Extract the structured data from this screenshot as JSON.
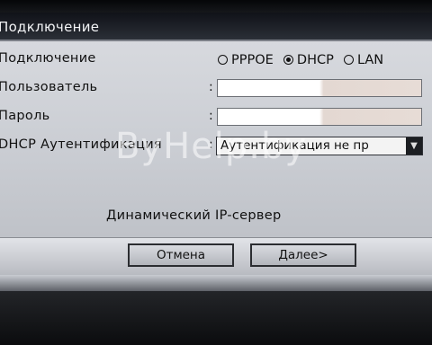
{
  "window": {
    "title": "Подключение"
  },
  "form": {
    "connection": {
      "label": "Подключение",
      "options": [
        {
          "label": "PPPOE",
          "selected": false
        },
        {
          "label": "DHCP",
          "selected": true
        },
        {
          "label": "LAN",
          "selected": false
        }
      ]
    },
    "user": {
      "label": "Пользователь",
      "colon": ":",
      "value": ""
    },
    "password": {
      "label": "Пароль",
      "colon": ":",
      "value": ""
    },
    "dhcp_auth": {
      "label": "DHCP Аутентификация",
      "colon": ":",
      "value": "Аутентификация не пр"
    }
  },
  "note": "Динамический IP-сервер",
  "buttons": {
    "cancel": "Отмена",
    "next": "Далее>"
  },
  "watermark": "ByHelp.by"
}
